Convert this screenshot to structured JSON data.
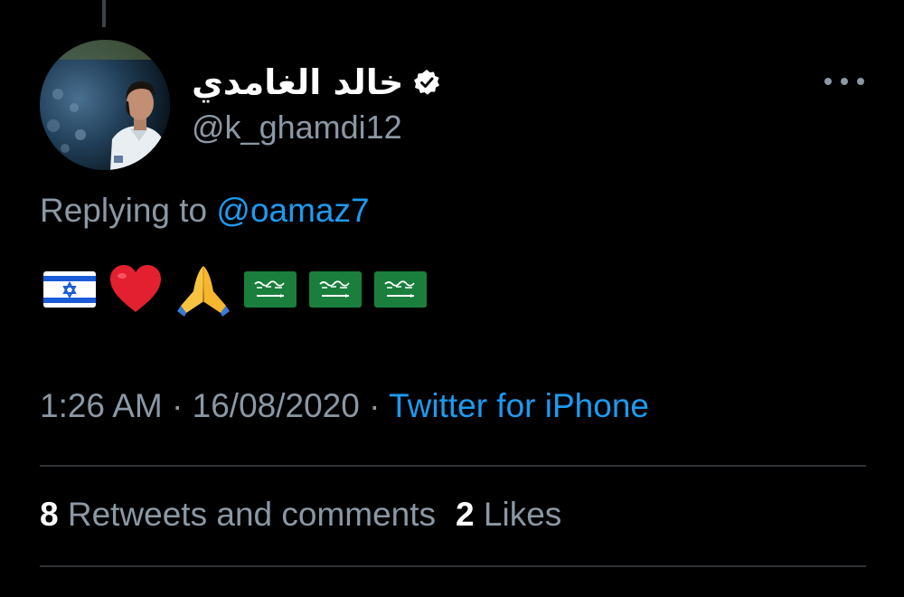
{
  "tweet": {
    "author": {
      "display_name": "خالد الغامدي",
      "handle": "@k_ghamdi12",
      "verified": true,
      "avatar_icon": "profile-photo"
    },
    "replying_prefix": "Replying to ",
    "replying_to": "@oamaz7",
    "emojis": [
      "flag-israel-icon",
      "red-heart-icon",
      "folded-hands-icon",
      "flag-saudi-arabia-icon",
      "flag-saudi-arabia-icon",
      "flag-saudi-arabia-icon"
    ],
    "time": "1:26 AM",
    "separator": " · ",
    "date": "16/08/2020",
    "source": "Twitter for iPhone",
    "stats": {
      "retweets_count": "8",
      "retweets_label": " Retweets and comments",
      "likes_count": "2",
      "likes_label": " Likes"
    }
  },
  "colors": {
    "background": "#000000",
    "text_primary": "#ffffff",
    "text_secondary": "#8b98a5",
    "link": "#1d9bf0",
    "divider": "#2f3336"
  }
}
